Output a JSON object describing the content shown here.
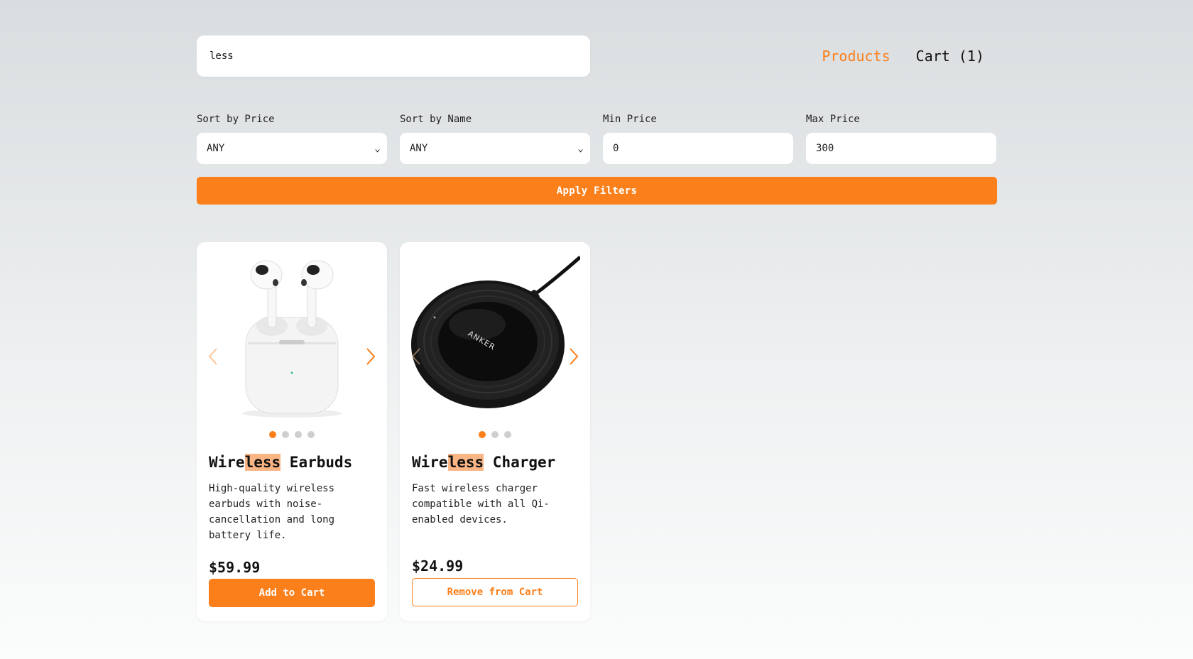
{
  "search": {
    "value": "less"
  },
  "nav": {
    "products_label": "Products",
    "cart_label": "Cart (1)"
  },
  "filters": {
    "sort_price": {
      "label": "Sort by Price",
      "value": "ANY"
    },
    "sort_name": {
      "label": "Sort by Name",
      "value": "ANY"
    },
    "min_price": {
      "label": "Min Price",
      "value": "0"
    },
    "max_price": {
      "label": "Max Price",
      "value": "300"
    },
    "apply_label": "Apply Filters"
  },
  "products": [
    {
      "title_pre": "Wire",
      "title_hl": "less",
      "title_post": " Earbuds",
      "description": "High-quality wireless earbuds with noise-cancellation and long battery life.",
      "price": "$59.99",
      "button_label": "Add to Cart",
      "image_count": 4,
      "active_image": 1,
      "image": "wireless-earbuds-image"
    },
    {
      "title_pre": "Wire",
      "title_hl": "less",
      "title_post": " Charger",
      "description": "Fast wireless charger compatible with all Qi-enabled devices.",
      "price": "$24.99",
      "button_label": "Remove from Cart",
      "image_count": 3,
      "active_image": 1,
      "image": "wireless-charger-image",
      "image_brand_text": "ANKER"
    }
  ],
  "colors": {
    "accent": "#fb7f1a",
    "highlight": "#f9b584"
  }
}
